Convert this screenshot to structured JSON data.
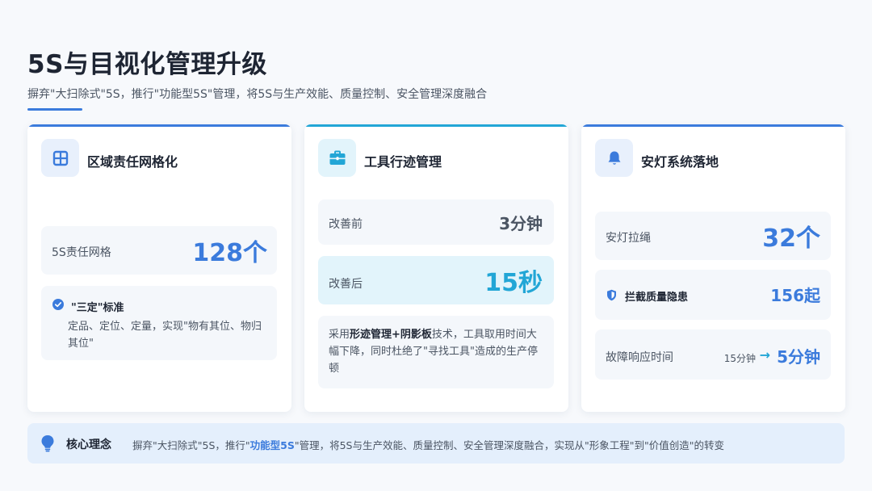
{
  "header": {
    "title": "5S与目视化管理升级",
    "subtitle": "摒弃\"大扫除式\"5S，推行\"功能型5S\"管理，将5S与生产效能、质量控制、安全管理深度融合"
  },
  "colors": {
    "accent_blue": "#3b7bdc",
    "accent_cyan": "#22a6d6",
    "text_dark": "#1e2533"
  },
  "cards": [
    {
      "icon": "grid-icon",
      "title": "区域责任网格化",
      "metric_label": "5S责任网格",
      "metric_value": "128个",
      "note_title": "\"三定\"标准",
      "note_text": "定品、定位、定量，实现\"物有其位、物归其位\""
    },
    {
      "icon": "toolbox-icon",
      "title": "工具行迹管理",
      "before_label": "改善前",
      "before_value": "3分钟",
      "after_label": "改善后",
      "after_value": "15秒",
      "desc_pre": "采用",
      "desc_bold": "形迹管理+阴影板",
      "desc_post": "技术，工具取用时间大幅下降，同时杜绝了\"寻找工具\"造成的生产停顿"
    },
    {
      "icon": "bell-icon",
      "title": "安灯系统落地",
      "andon_label": "安灯拉绳",
      "andon_value": "32个",
      "quality_label": "拦截质量隐患",
      "quality_value": "156起",
      "response_label": "故障响应时间",
      "response_old": "15分钟",
      "response_arrow": "→",
      "response_new": "5分钟"
    }
  ],
  "core": {
    "icon": "lightbulb-icon",
    "title": "核心理念",
    "text_pre": "摒弃\"大扫除式\"5S，推行\"",
    "text_bold": "功能型5S",
    "text_post": "\"管理，将5S与生产效能、质量控制、安全管理深度融合，实现从\"形象工程\"到\"价值创造\"的转变"
  }
}
